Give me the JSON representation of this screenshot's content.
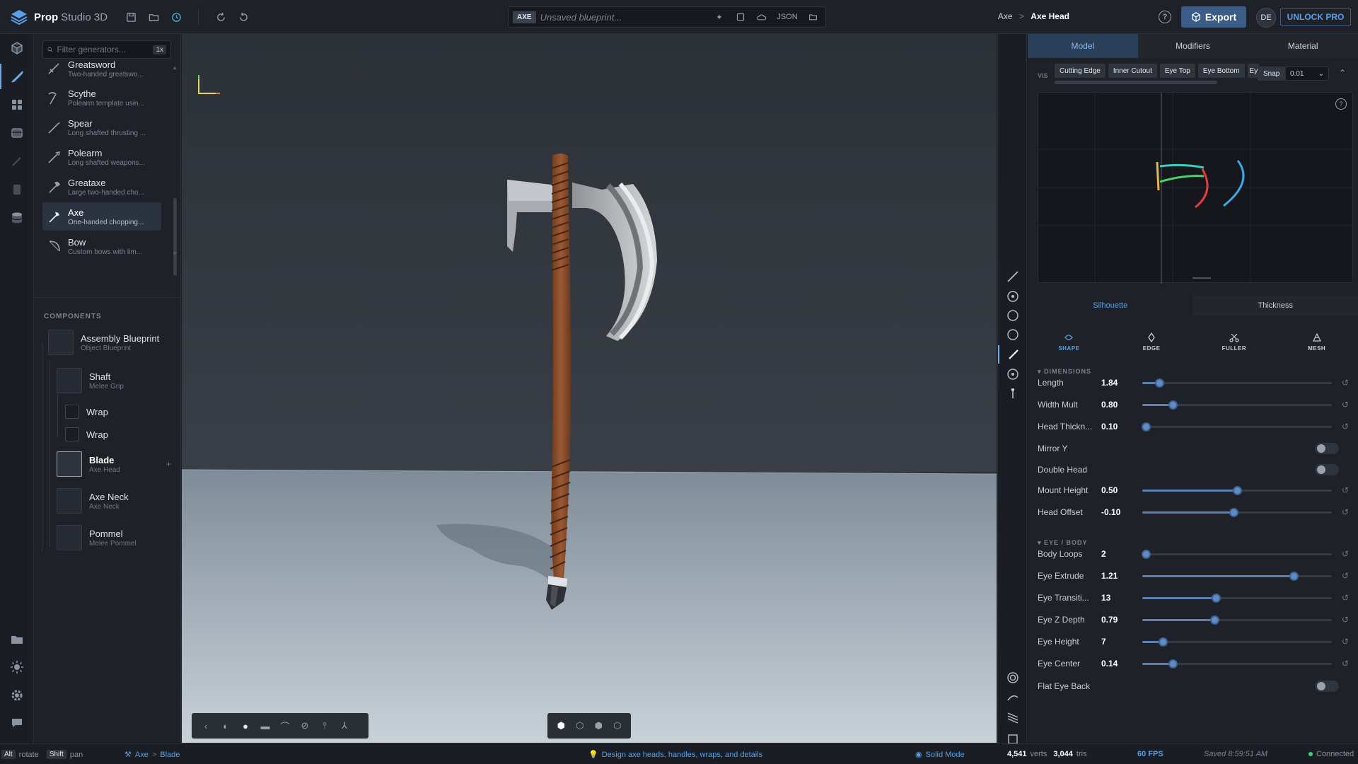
{
  "app": {
    "brand": "Prop",
    "subtitle": "Studio 3D"
  },
  "doc": {
    "tag": "AXE",
    "name": "Unsaved blueprint...",
    "json_label": "JSON"
  },
  "breadcrumb": {
    "parent": "Axe",
    "sep": ">",
    "current": "Axe Head"
  },
  "header": {
    "export_label": "Export",
    "avatar": "DE",
    "unlock_label": "UNLOCK PRO"
  },
  "generators": {
    "filter_placeholder": "Filter generators...",
    "filter_kbd": "1x",
    "items": [
      {
        "name": "Greatsword",
        "desc": "Two-handed greatswo...",
        "icon": "sword-icon"
      },
      {
        "name": "Scythe",
        "desc": "Polearm template usin...",
        "icon": "scythe-icon"
      },
      {
        "name": "Spear",
        "desc": "Long shafted thrusting ...",
        "icon": "spear-icon"
      },
      {
        "name": "Polearm",
        "desc": "Long shafted weapons...",
        "icon": "polearm-icon"
      },
      {
        "name": "Greataxe",
        "desc": "Large two-handed cho...",
        "icon": "greataxe-icon"
      },
      {
        "name": "Axe",
        "desc": "One-handed chopping...",
        "icon": "axe-icon"
      },
      {
        "name": "Bow",
        "desc": "Custom bows with lim...",
        "icon": "bow-icon"
      }
    ],
    "selected": "Axe"
  },
  "components": {
    "heading": "COMPONENTS",
    "assembly": {
      "name": "Assembly Blueprint",
      "type": "Object Blueprint"
    },
    "shaft": {
      "name": "Shaft",
      "type": "Melee Grip"
    },
    "wrap1": {
      "name": "Wrap"
    },
    "wrap2": {
      "name": "Wrap"
    },
    "blade": {
      "name": "Blade",
      "type": "Axe Head",
      "add": "+"
    },
    "neck": {
      "name": "Axe Neck",
      "type": "Axe Neck"
    },
    "pommel": {
      "name": "Pommel",
      "type": "Melee Pommel"
    }
  },
  "panel": {
    "tabs": [
      "Model",
      "Modifiers",
      "Material"
    ],
    "active_tab": "Model",
    "vis_label": "VIS",
    "curve_chips": [
      "Cutting Edge",
      "Inner Cutout",
      "Eye Top",
      "Eye Bottom",
      "Ey"
    ],
    "snap_label": "Snap",
    "snap_value": "0.01",
    "help": "?",
    "subtabs": [
      "Silhouette",
      "Thickness"
    ],
    "active_subtab": "Silhouette",
    "modes": [
      "SHAPE",
      "EDGE",
      "FULLER",
      "MESH"
    ],
    "active_mode": "SHAPE",
    "dimensions": {
      "title": "DIMENSIONS",
      "length": {
        "label": "Length",
        "value": "1.84",
        "frac": 0.09
      },
      "width": {
        "label": "Width Mult",
        "value": "0.80",
        "frac": 0.16
      },
      "thick": {
        "label": "Head Thickn...",
        "value": "0.10",
        "frac": 0.02
      },
      "mirror": {
        "label": "Mirror Y",
        "on": false
      },
      "double": {
        "label": "Double Head",
        "on": false
      },
      "mount": {
        "label": "Mount Height",
        "value": "0.50",
        "frac": 0.5
      },
      "offset": {
        "label": "Head Offset",
        "value": "-0.10",
        "frac": 0.48
      }
    },
    "eye": {
      "title": "EYE / BODY",
      "loops": {
        "label": "Body Loops",
        "value": "2",
        "frac": 0.02
      },
      "extrude": {
        "label": "Eye Extrude",
        "value": "1.21",
        "frac": 0.8
      },
      "transition": {
        "label": "Eye Transiti...",
        "value": "13",
        "frac": 0.39
      },
      "zdepth": {
        "label": "Eye Z Depth",
        "value": "0.79",
        "frac": 0.38
      },
      "height": {
        "label": "Eye Height",
        "value": "7",
        "frac": 0.11
      },
      "center": {
        "label": "Eye Center",
        "value": "0.14",
        "frac": 0.16
      },
      "flat": {
        "label": "Flat Eye Back",
        "on": false
      }
    }
  },
  "status": {
    "alt": "Alt",
    "rotate": "rotate",
    "shift": "Shift",
    "pan": "pan",
    "crumb_a": "Axe",
    "crumb_sep": ">",
    "crumb_b": "Blade",
    "tip": "Design axe heads, handles, wraps, and details",
    "mode": "Solid Mode",
    "verts": "4,541",
    "verts_lbl": "verts",
    "tris": "3,044",
    "tris_lbl": "tris",
    "fps": "60 FPS",
    "saved": "Saved 8:59:51 AM",
    "conn": "Connected"
  },
  "colors": {
    "accent": "#5aa0e8",
    "export": "#3b5c86",
    "handle": "#8a4f2c",
    "head": "#b9bcc1",
    "fps": "#5aa0e8"
  }
}
